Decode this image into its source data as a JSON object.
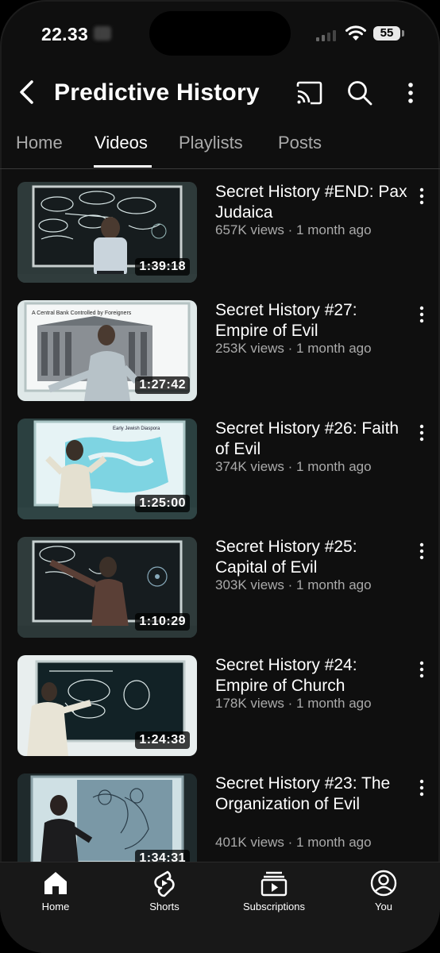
{
  "status_bar": {
    "time": "22.33",
    "battery": "55"
  },
  "header": {
    "title": "Predictive History"
  },
  "tabs": [
    {
      "label": "Home"
    },
    {
      "label": "Videos"
    },
    {
      "label": "Playlists"
    },
    {
      "label": "Posts"
    }
  ],
  "videos": [
    {
      "title": "Secret History #END: Pax Judaica",
      "meta": "657K views · 1 month ago",
      "duration": "1:39:18"
    },
    {
      "title": "Secret History #27: Empire of Evil",
      "meta": "253K views · 1 month ago",
      "duration": "1:27:42"
    },
    {
      "title": "Secret History #26: Faith of Evil",
      "meta": "374K views · 1 month ago",
      "duration": "1:25:00"
    },
    {
      "title": "Secret History #25: Capital of Evil",
      "meta": "303K views · 1 month ago",
      "duration": "1:10:29"
    },
    {
      "title": "Secret History #24: Empire of Church",
      "meta": "178K views · 1 month ago",
      "duration": "1:24:38"
    },
    {
      "title": "Secret History #23: The Organization of Evil",
      "meta": "401K views · 1 month ago",
      "duration": "1:34:31"
    }
  ],
  "thumb_texts": {
    "slide_2_heading": "A Central Bank Controlled by Foreigners",
    "slide_3_heading": "Early Jewish Diaspora"
  },
  "bottom_nav": [
    {
      "label": "Home",
      "icon": "home-icon"
    },
    {
      "label": "Shorts",
      "icon": "shorts-icon"
    },
    {
      "label": "Subscriptions",
      "icon": "subscriptions-icon"
    },
    {
      "label": "You",
      "icon": "you-icon"
    }
  ]
}
